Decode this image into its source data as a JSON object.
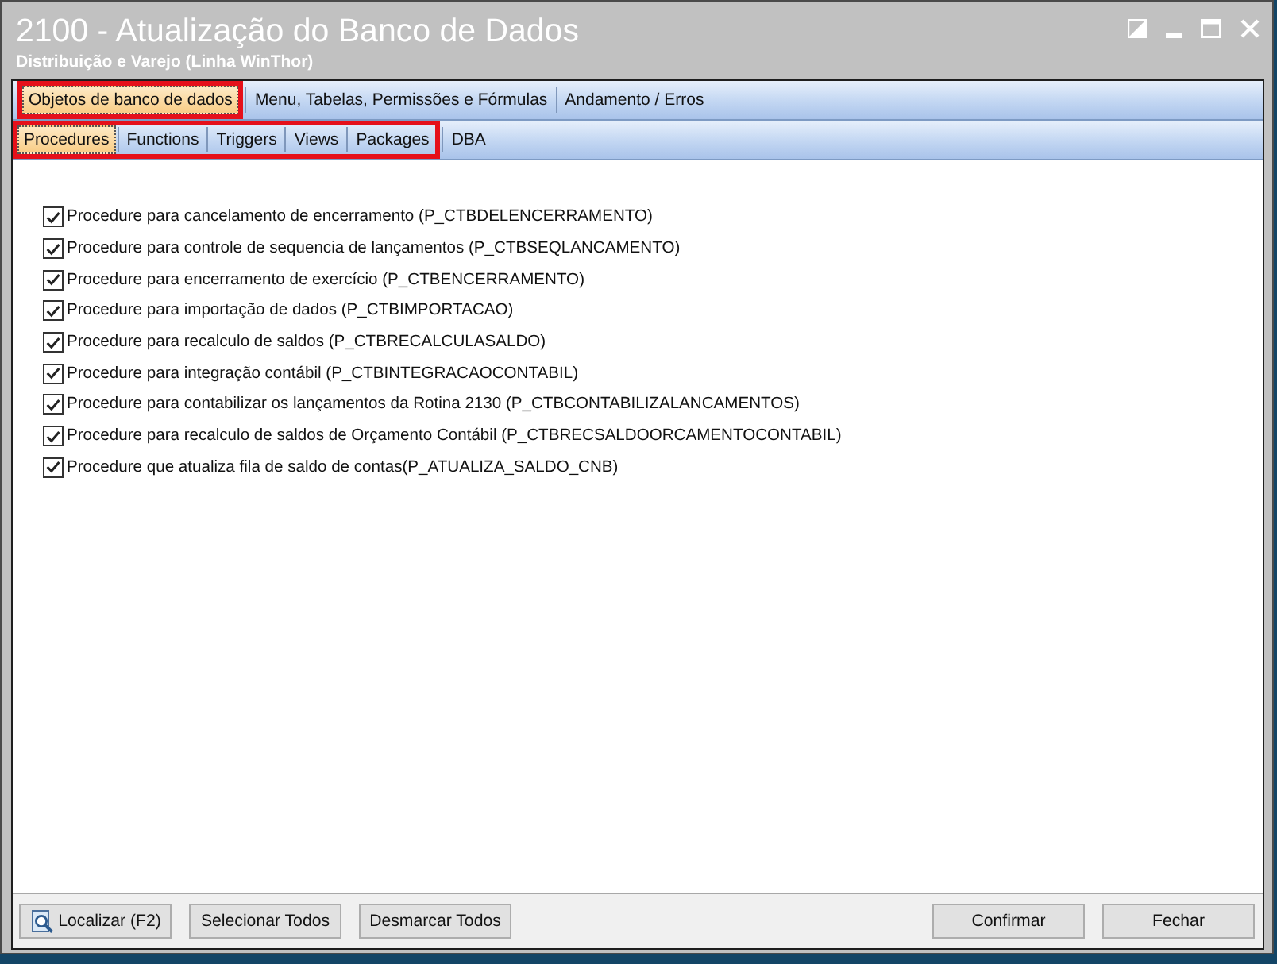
{
  "window": {
    "title": "2100 - Atualização do Banco de Dados",
    "subtitle": "Distribuição e Varejo (Linha WinThor)"
  },
  "tab_rows": [
    {
      "tabs": [
        {
          "label": "Objetos de banco de dados",
          "selected": true,
          "highlighted": true
        },
        {
          "label": "Menu, Tabelas, Permissões e Fórmulas",
          "selected": false,
          "highlighted": false
        },
        {
          "label": "Andamento / Erros",
          "selected": false,
          "highlighted": false
        }
      ]
    },
    {
      "tabs": [
        {
          "label": "Procedures",
          "selected": true,
          "highlighted": true
        },
        {
          "label": "Functions",
          "selected": false,
          "highlighted": true
        },
        {
          "label": "Triggers",
          "selected": false,
          "highlighted": true
        },
        {
          "label": "Views",
          "selected": false,
          "highlighted": true
        },
        {
          "label": "Packages",
          "selected": false,
          "highlighted": true
        },
        {
          "label": "DBA",
          "selected": false,
          "highlighted": false
        }
      ]
    }
  ],
  "procedures": [
    {
      "label": "Procedure para cancelamento de encerramento (P_CTBDELENCERRAMENTO)",
      "checked": true
    },
    {
      "label": "Procedure para controle de sequencia de lançamentos (P_CTBSEQLANCAMENTO)",
      "checked": true
    },
    {
      "label": "Procedure para encerramento de exercício (P_CTBENCERRAMENTO)",
      "checked": true
    },
    {
      "label": "Procedure para importação de dados (P_CTBIMPORTACAO)",
      "checked": true
    },
    {
      "label": "Procedure para recalculo de saldos (P_CTBRECALCULASALDO)",
      "checked": true
    },
    {
      "label": "Procedure para integração contábil (P_CTBINTEGRACAOCONTABIL)",
      "checked": true
    },
    {
      "label": "Procedure para contabilizar os lançamentos da Rotina 2130 (P_CTBCONTABILIZALANCAMENTOS)",
      "checked": true
    },
    {
      "label": "Procedure para recalculo de saldos de Orçamento Contábil (P_CTBRECSALDOORCAMENTOCONTABIL)",
      "checked": true
    },
    {
      "label": "Procedure que atualiza fila de saldo de contas(P_ATUALIZA_SALDO_CNB)",
      "checked": true
    }
  ],
  "left_buttons": [
    {
      "label": "Localizar (F2)",
      "kind": "search"
    },
    {
      "label": "Selecionar Todos",
      "kind": "plain"
    },
    {
      "label": "Desmarcar Todos",
      "kind": "plain"
    }
  ],
  "right_buttons": [
    {
      "label": "Confirmar",
      "kind": "plain"
    },
    {
      "label": "Fechar",
      "kind": "plain"
    }
  ]
}
